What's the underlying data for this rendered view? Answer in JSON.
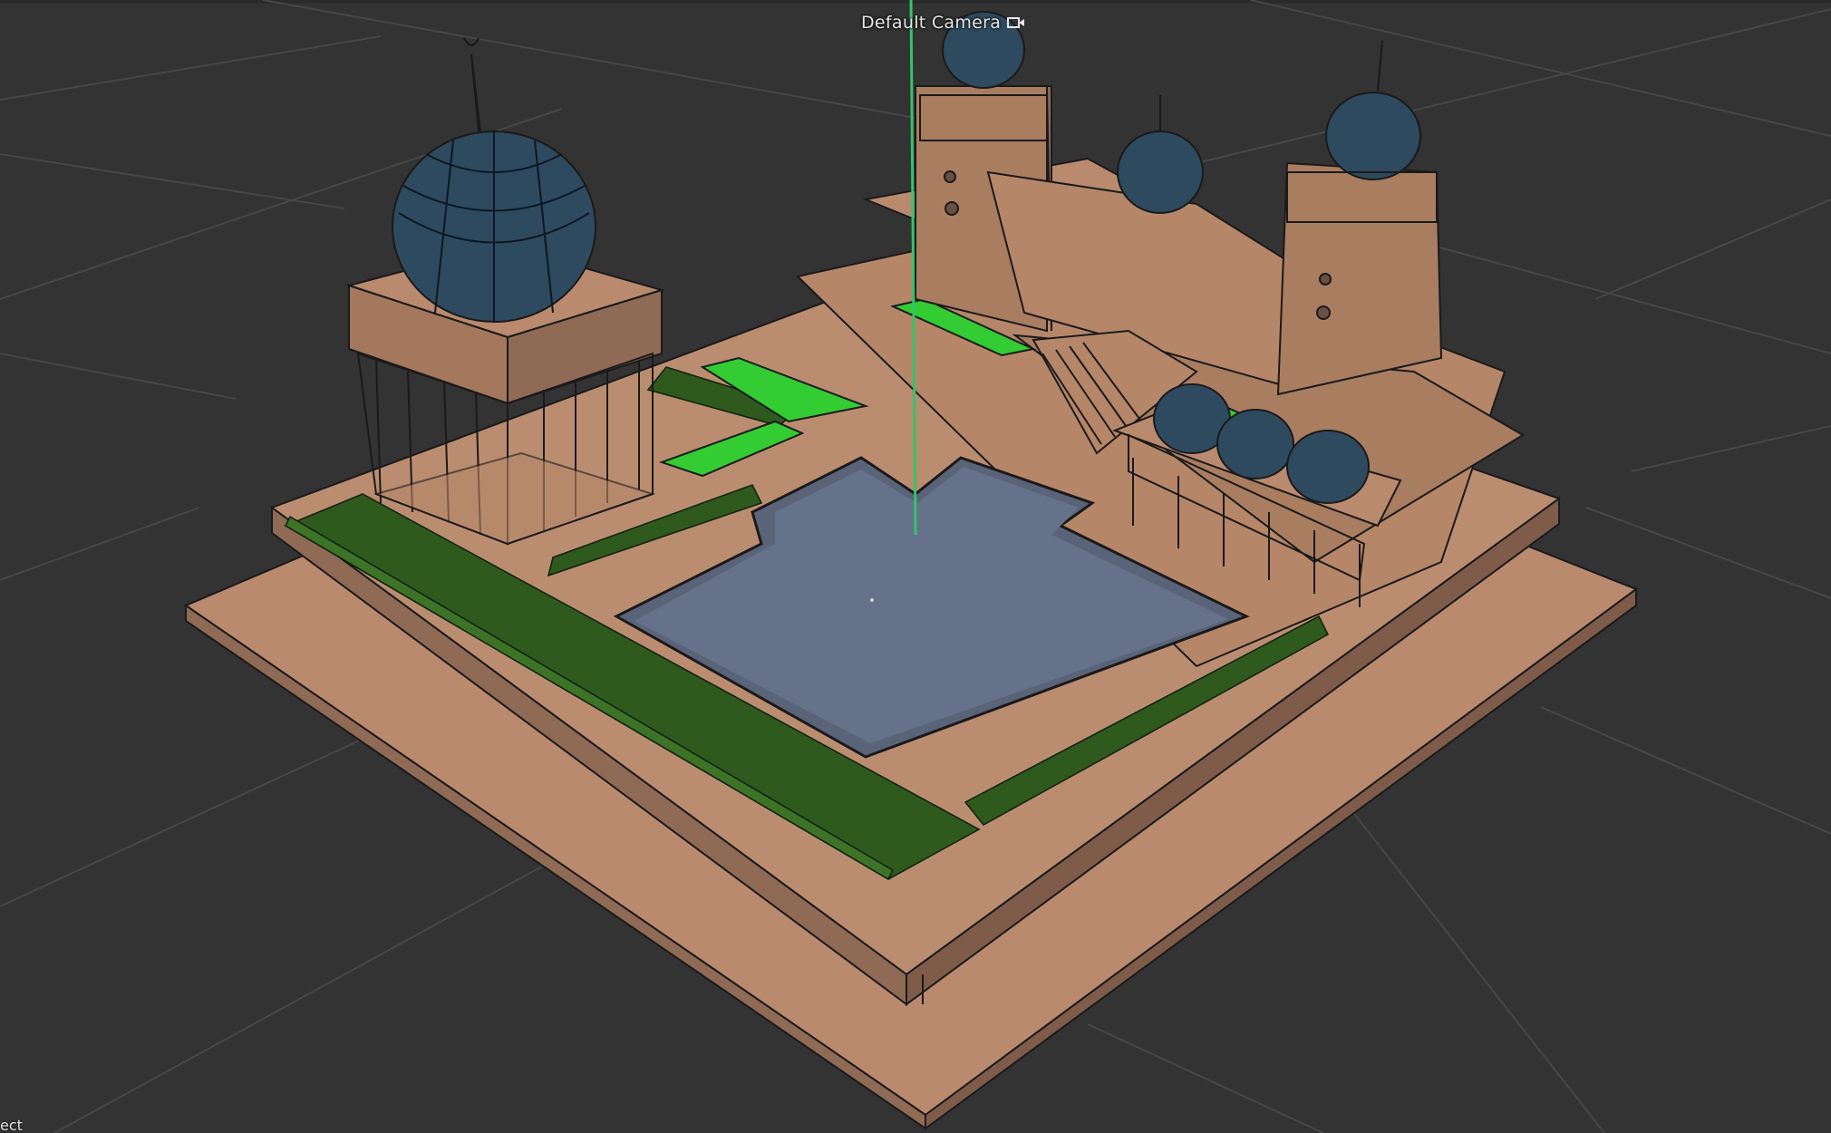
{
  "viewport": {
    "camera_label": "Default Camera",
    "camera_icon": "camera-icon",
    "status_text": "ect",
    "background": "#333333",
    "grid_color": "#474747",
    "axis_color": "#33c46b"
  },
  "scene": {
    "colors": {
      "terrain": "#b98a6e",
      "terrain_dark": "#8f6a55",
      "terrain_side": "#7f5c49",
      "dome": "#2e4a5e",
      "dome_light": "#4a6c82",
      "water": "#5a6478",
      "grass": "#33cc33",
      "hedge": "#2f5a1e",
      "edge": "#1a1a1a"
    }
  }
}
